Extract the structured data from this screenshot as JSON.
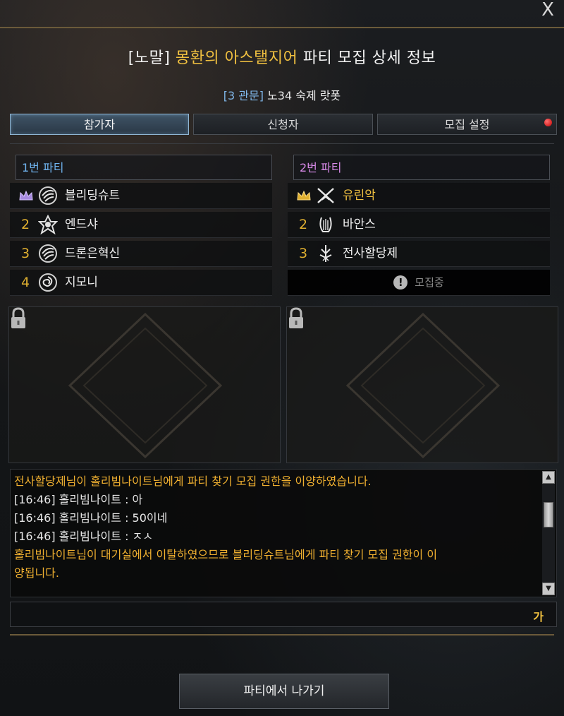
{
  "window": {
    "close_label": "X",
    "title_prefix": "[노말] ",
    "title_raid": "몽환의 아스탤지어",
    "title_suffix": " 파티 모집 상세 정보",
    "subtitle_gate": "[3 관문]",
    "subtitle_text": " 노34 숙제 랏폿"
  },
  "tabs": [
    {
      "label": "참가자",
      "active": true
    },
    {
      "label": "신청자",
      "active": false
    },
    {
      "label": "모집 설정",
      "active": false,
      "notification": true
    }
  ],
  "parties": [
    {
      "header": "1번 파티",
      "header_color": "#6fb3ee",
      "members": [
        {
          "slot": "",
          "leader": true,
          "crown_color": "#a78ae0",
          "class_icon": "gunslinger-icon",
          "name": "블리딩슈트",
          "name_color": "#f0f0f0"
        },
        {
          "slot": "2",
          "leader": false,
          "class_icon": "destroyer-icon",
          "name": "엔드샤",
          "name_color": "#f0f0f0"
        },
        {
          "slot": "3",
          "leader": false,
          "class_icon": "gunslinger-icon",
          "name": "드론은혁신",
          "name_color": "#f0f0f0"
        },
        {
          "slot": "4",
          "leader": false,
          "class_icon": "summoner-icon",
          "name": "지모니",
          "name_color": "#f0f0f0"
        }
      ]
    },
    {
      "header": "2번 파티",
      "header_color": "#d88ae8",
      "members": [
        {
          "slot": "",
          "leader": true,
          "crown_color": "#e0b030",
          "class_icon": "slayer-icon",
          "name": "유린악",
          "name_color": "#f0c040"
        },
        {
          "slot": "2",
          "leader": false,
          "class_icon": "bard-icon",
          "name": "바안스",
          "name_color": "#f0f0f0"
        },
        {
          "slot": "3",
          "leader": false,
          "class_icon": "holyknight-icon",
          "name": "전사할당제",
          "name_color": "#f0f0f0"
        }
      ],
      "recruiting_label": "모집중"
    }
  ],
  "chat": {
    "lines": [
      {
        "type": "sys",
        "text": "전사할당제님이 홀리빔나이트님에게 파티 찾기 모집 권한을 이양하였습니다."
      },
      {
        "type": "msg",
        "text": "[16:46] 홀리빔나이트 : 아"
      },
      {
        "type": "msg",
        "text": "[16:46] 홀리빔나이트 : 50이네"
      },
      {
        "type": "msg",
        "text": "[16:46] 홀리빔나이트 : ㅈㅅ"
      },
      {
        "type": "sys",
        "text": "홀리빔나이트님이 대기실에서 이탈하였으므로 블리딩슈트님에게 파티 찾기 모집 권한이 이"
      },
      {
        "type": "sys",
        "text": "양됩니다."
      }
    ],
    "input_value": "",
    "input_lang": "가"
  },
  "footer": {
    "leave_label": "파티에서 나가기"
  }
}
